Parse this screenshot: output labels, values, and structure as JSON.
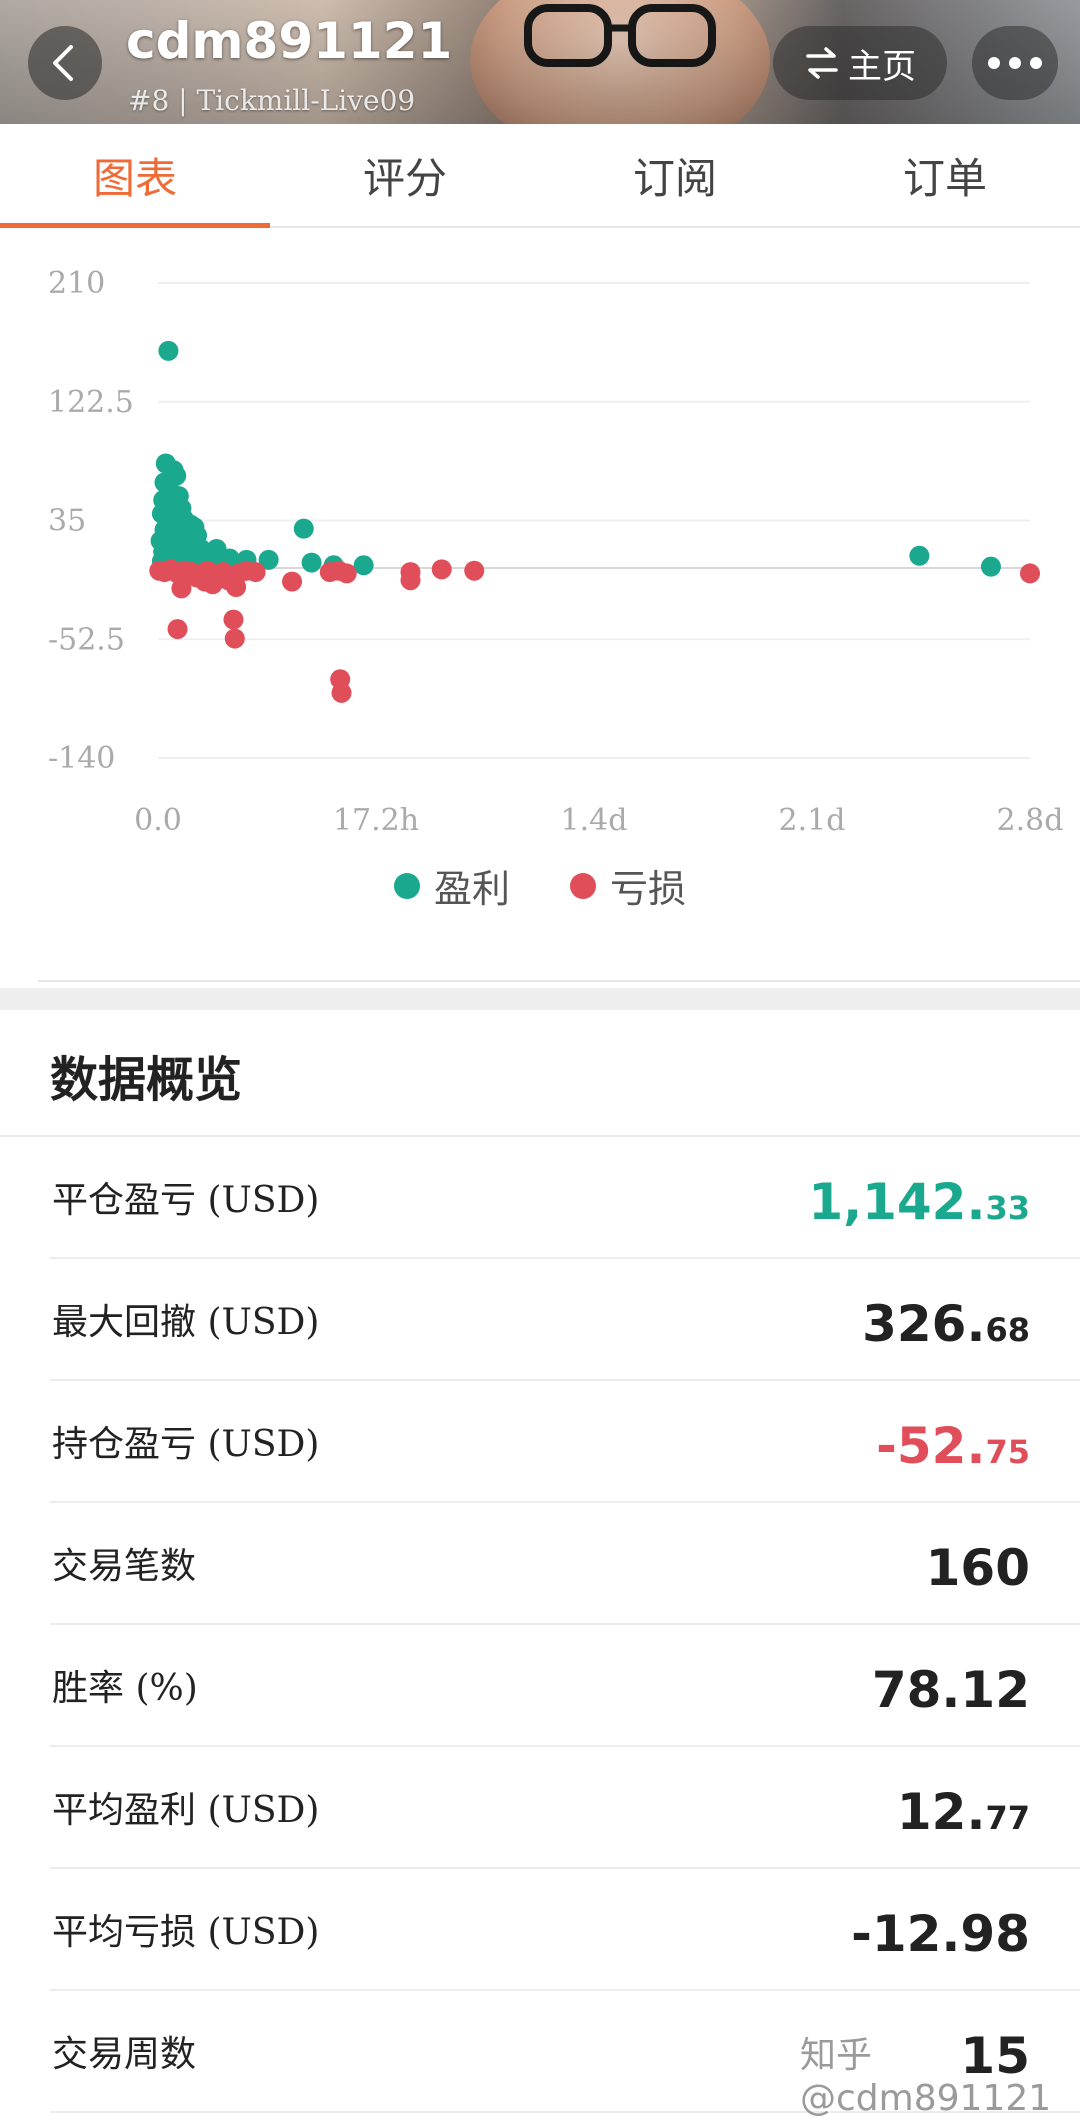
{
  "header": {
    "username": "cdm891121",
    "subtitle": "#8 | Tickmill-Live09",
    "home_label": "主页",
    "home_icon": "swap-arrows-icon",
    "back_icon": "chevron-left-icon",
    "more_icon": "more-dots-icon"
  },
  "tabs": [
    {
      "label": "图表",
      "active": true
    },
    {
      "label": "评分",
      "active": false
    },
    {
      "label": "订阅",
      "active": false
    },
    {
      "label": "订单",
      "active": false
    }
  ],
  "chart_data": {
    "type": "scatter",
    "x_unit": "hours",
    "xlim": [
      0,
      67
    ],
    "ylim": [
      -140,
      210
    ],
    "y_ticks": [
      "210",
      "122.5",
      "35",
      "-52.5",
      "-140"
    ],
    "x_ticks": [
      "0.0",
      "17.2h",
      "1.4d",
      "2.1d",
      "2.8d"
    ],
    "x_tick_values": [
      0,
      16.75,
      33.5,
      50.25,
      67
    ],
    "grid": true,
    "legend_position": "bottom",
    "series": [
      {
        "name": "盈利",
        "color": "#1aa98e",
        "points": [
          [
            0.8,
            160
          ],
          [
            0.6,
            77
          ],
          [
            1.2,
            72
          ],
          [
            1.4,
            68
          ],
          [
            0.5,
            63
          ],
          [
            0.9,
            57
          ],
          [
            1.6,
            53
          ],
          [
            0.4,
            50
          ],
          [
            1.3,
            48
          ],
          [
            0.7,
            45
          ],
          [
            1.8,
            44
          ],
          [
            0.3,
            40
          ],
          [
            1.1,
            38
          ],
          [
            2.0,
            36
          ],
          [
            2.5,
            32
          ],
          [
            2.8,
            30
          ],
          [
            0.5,
            28
          ],
          [
            1.5,
            26
          ],
          [
            2.2,
            25
          ],
          [
            3.0,
            24
          ],
          [
            0.2,
            20
          ],
          [
            0.9,
            18
          ],
          [
            1.7,
            16
          ],
          [
            2.6,
            15
          ],
          [
            3.3,
            14
          ],
          [
            4.5,
            14
          ],
          [
            0.4,
            12
          ],
          [
            1.2,
            10
          ],
          [
            2.0,
            9
          ],
          [
            3.5,
            8
          ],
          [
            5.5,
            7
          ],
          [
            6.8,
            6
          ],
          [
            8.5,
            6
          ],
          [
            0.3,
            5
          ],
          [
            1.0,
            4
          ],
          [
            2.4,
            3
          ],
          [
            4.0,
            3
          ],
          [
            5.0,
            2
          ],
          [
            0.6,
            2
          ],
          [
            1.9,
            1
          ],
          [
            11.2,
            29
          ],
          [
            11.8,
            4
          ],
          [
            13.5,
            2
          ],
          [
            15.8,
            2
          ],
          [
            58.5,
            9
          ],
          [
            64,
            1
          ]
        ]
      },
      {
        "name": "亏损",
        "color": "#e04e5a",
        "points": [
          [
            0.1,
            -2
          ],
          [
            0.5,
            -3
          ],
          [
            1.0,
            -1
          ],
          [
            1.5,
            -4
          ],
          [
            2.0,
            -2
          ],
          [
            2.6,
            -3
          ],
          [
            3.2,
            -5
          ],
          [
            3.8,
            -2
          ],
          [
            4.4,
            -6
          ],
          [
            5.0,
            -3
          ],
          [
            5.6,
            -8
          ],
          [
            6.2,
            -4
          ],
          [
            6.8,
            -2
          ],
          [
            7.5,
            -3
          ],
          [
            1.8,
            -15
          ],
          [
            3.0,
            -7
          ],
          [
            3.6,
            -10
          ],
          [
            4.2,
            -12
          ],
          [
            5.4,
            -9
          ],
          [
            6.0,
            -14
          ],
          [
            1.5,
            -45
          ],
          [
            5.8,
            -38
          ],
          [
            5.9,
            -52
          ],
          [
            10.3,
            -10
          ],
          [
            13.2,
            -3
          ],
          [
            13.9,
            -2
          ],
          [
            14.5,
            -4
          ],
          [
            14.0,
            -82
          ],
          [
            14.1,
            -92
          ],
          [
            19.4,
            -3
          ],
          [
            19.4,
            -9
          ],
          [
            21.8,
            -1
          ],
          [
            24.3,
            -2
          ],
          [
            67,
            -4
          ]
        ]
      }
    ]
  },
  "overview": {
    "title": "数据概览",
    "rows": [
      {
        "label": "平仓盈亏 (USD)",
        "int": "1,142.",
        "dec": "33",
        "color": "green"
      },
      {
        "label": "最大回撤 (USD)",
        "int": "326.",
        "dec": "68",
        "color": ""
      },
      {
        "label": "持仓盈亏 (USD)",
        "int": "-52.",
        "dec": "75",
        "color": "red"
      },
      {
        "label": "交易笔数",
        "int": "160",
        "dec": "",
        "color": ""
      },
      {
        "label": "胜率 (%)",
        "int": "78.12",
        "dec": "",
        "color": ""
      },
      {
        "label": "平均盈利 (USD)",
        "int": "12.",
        "dec": "77",
        "color": ""
      },
      {
        "label": "平均亏损 (USD)",
        "int": "-12.98",
        "dec": "",
        "color": ""
      },
      {
        "label": "交易周数",
        "int": "15",
        "dec": "",
        "color": ""
      }
    ]
  },
  "watermark": "知乎 @cdm891121"
}
